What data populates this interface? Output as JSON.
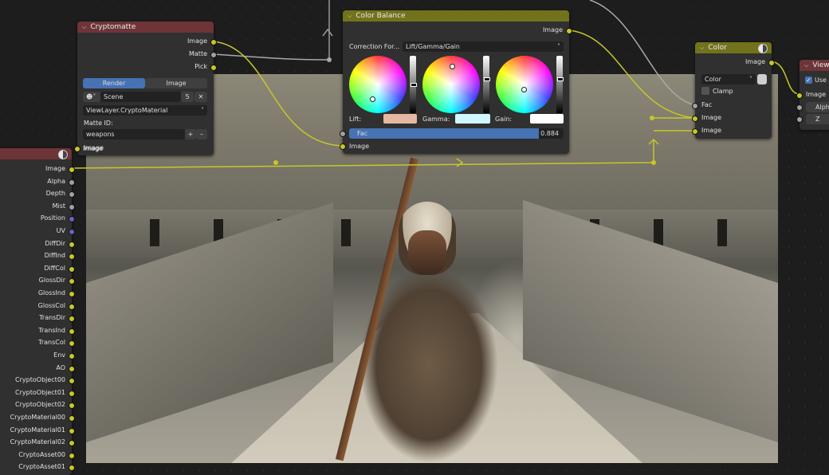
{
  "cryptomatte": {
    "title": "Cryptomatte",
    "outputs": [
      "Image",
      "Matte",
      "Pick"
    ],
    "tabs": [
      "Render",
      "Image"
    ],
    "scene_label": "Scene",
    "scene_users": "5",
    "layer_value": "ViewLayer.CryptoMaterial",
    "matte_id_label": "Matte ID:",
    "matte_id_value": "weapons",
    "input_image": "Image"
  },
  "color_balance": {
    "title": "Color Balance",
    "output": "Image",
    "correction_label": "Correction For...",
    "correction_value": "Lift/Gamma/Gain",
    "lift_label": "Lift:",
    "gamma_label": "Gamma:",
    "gain_label": "Gain:",
    "fac_label": "Fac",
    "fac_value": "0.884",
    "input_image": "Image"
  },
  "color_node": {
    "title": "Color",
    "output": "Image",
    "blend_mode": "Color",
    "clamp_label": "Clamp",
    "inputs": [
      "Fac",
      "Image",
      "Image"
    ]
  },
  "viewer_node": {
    "title": "Viewe",
    "use_alpha": "Use A",
    "inputs": [
      "Image",
      "Alpha",
      "Z"
    ]
  },
  "render_layers": {
    "outputs": [
      "Image",
      "Alpha",
      "Depth",
      "Mist",
      "Position",
      "UV",
      "DiffDir",
      "DiffInd",
      "DiffCol",
      "GlossDir",
      "GlossInd",
      "GlossCol",
      "TransDir",
      "TransInd",
      "TransCol",
      "Env",
      "AO",
      "CryptoObject00",
      "CryptoObject01",
      "CryptoObject02",
      "CryptoMaterial00",
      "CryptoMaterial01",
      "CryptoMaterial02",
      "CryptoAsset00",
      "CryptoAsset01"
    ],
    "top_input": "Image"
  },
  "colors": {
    "cryptomatte_header": "#6e3438",
    "color_balance_header": "#72721c",
    "color_node_header": "#72721c",
    "viewer_header": "#6e3438",
    "render_layers_header": "#6e3438",
    "active_blue": "#4772b3",
    "lift_swatch": "#e6b7a3",
    "gamma_swatch": "#d0f6ff",
    "gain_swatch": "#ffffff"
  }
}
